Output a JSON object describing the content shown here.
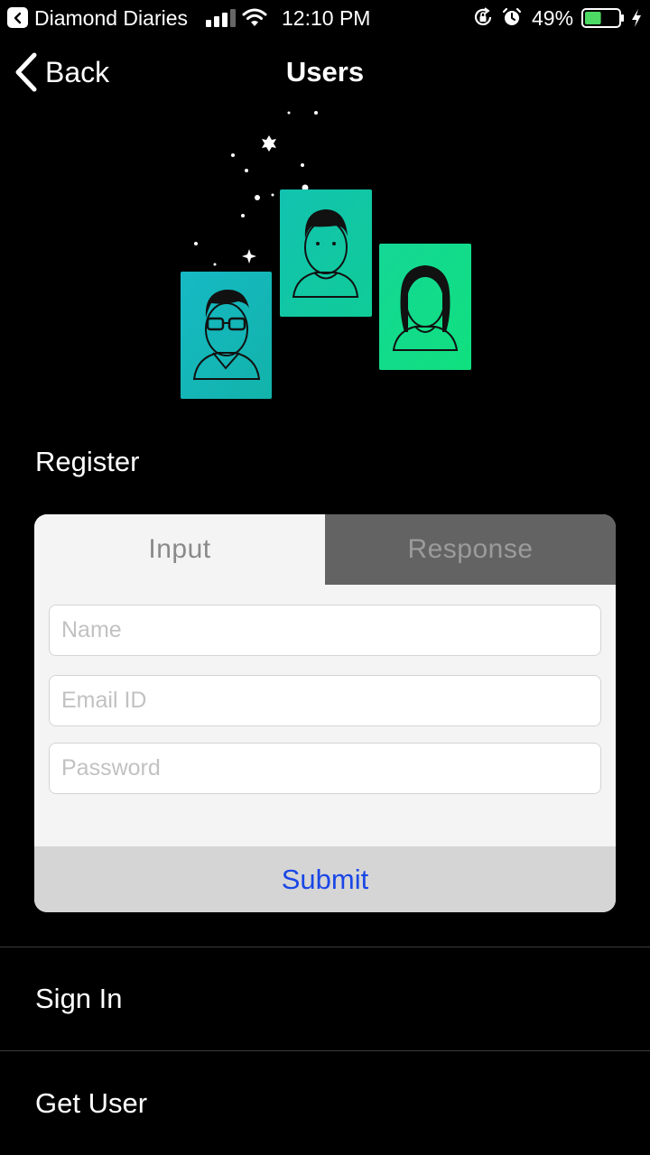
{
  "status_bar": {
    "back_app": "Diamond Diaries",
    "time": "12:10 PM",
    "battery": "49%",
    "battery_fill": 0.49,
    "battery_color": "#4cd964"
  },
  "nav": {
    "back_label": "Back",
    "title": "Users"
  },
  "illustration": {
    "icons": [
      "user-with-glasses-icon",
      "user-male-icon",
      "user-female-icon"
    ],
    "card_colors": [
      "#16b8b8",
      "#12c6a4",
      "#14d98a"
    ]
  },
  "section_title": "Register",
  "form": {
    "tabs": [
      {
        "label": "Input",
        "active": true
      },
      {
        "label": "Response",
        "active": false
      }
    ],
    "fields": {
      "name_placeholder": "Name",
      "email_placeholder": "Email ID",
      "password_placeholder": "Password"
    },
    "submit_label": "Submit",
    "accent": "#1a47e6"
  },
  "list": [
    {
      "label": "Sign In"
    },
    {
      "label": "Get User"
    }
  ]
}
